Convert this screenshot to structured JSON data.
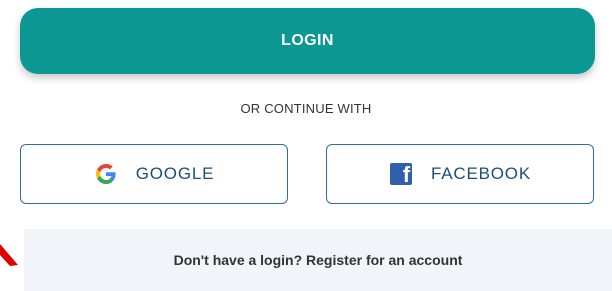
{
  "login": {
    "button_label": "LOGIN"
  },
  "separator": {
    "text": "OR CONTINUE WITH"
  },
  "social": {
    "google": {
      "label": "GOOGLE",
      "icon": "google-icon"
    },
    "facebook": {
      "label": "FACEBOOK",
      "icon": "facebook-icon"
    }
  },
  "register": {
    "text": "Don't have a login? Register for an account"
  },
  "colors": {
    "primary": "#0b9792",
    "social_border": "#2f6f9f",
    "social_text": "#1f4d78",
    "banner_background": "#f1f4f8",
    "arrow": "#e10000"
  }
}
